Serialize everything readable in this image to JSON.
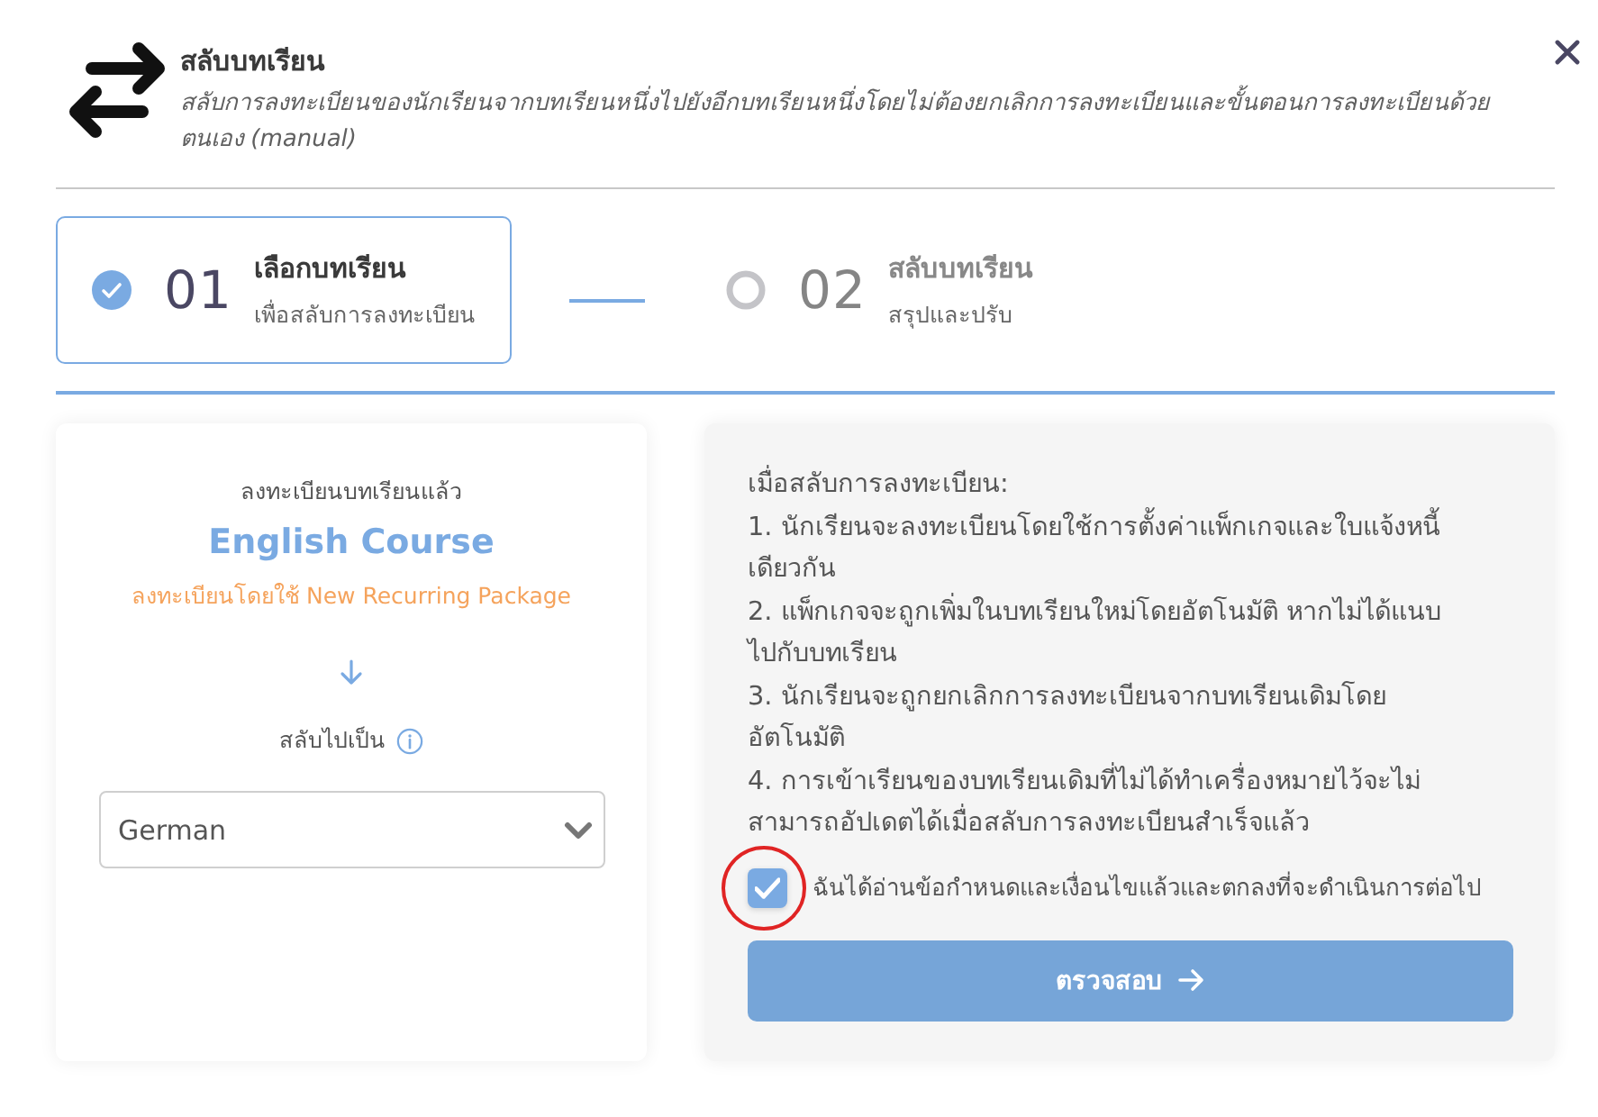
{
  "header": {
    "title": "สลับบทเรียน",
    "description": "สลับการลงทะเบียนของนักเรียนจากบทเรียนหนึ่งไปยังอีกบทเรียนหนึ่งโดยไม่ต้องยกเลิกการลงทะเบียนและขั้นตอนการลงทะเบียนด้วยตนเอง (manual)"
  },
  "steps": [
    {
      "number": "01",
      "title": "เลือกบทเรียน",
      "subtitle": "เพื่อสลับการลงทะเบียน",
      "selected": true
    },
    {
      "number": "02",
      "title": "สลับบทเรียน",
      "subtitle": "สรุปและปรับ",
      "selected": false
    }
  ],
  "source": {
    "label": "ลงทะเบียนบทเรียนแล้ว",
    "course": "English Course",
    "package_note": "ลงทะเบียนโดยใช้ New Recurring Package"
  },
  "target": {
    "label": "สลับไปเป็น",
    "select": {
      "value": "German"
    }
  },
  "notice": {
    "heading": "เมื่อสลับการลงทะเบียน:",
    "items": [
      "1. นักเรียนจะลงทะเบียนโดยใช้การตั้งค่าแพ็กเกจและใบแจ้งหนี้เดียวกัน",
      "2. แพ็กเกจจะถูกเพิ่มในบทเรียนใหม่โดยอัตโนมัติ หากไม่ได้แนบไปกับบทเรียน",
      "3. นักเรียนจะถูกยกเลิกการลงทะเบียนจากบทเรียนเดิมโดยอัตโนมัติ",
      "4. การเข้าเรียนของบทเรียนเดิมที่ไม่ได้ทำเครื่องหมายไว้จะไม่สามารถอัปเดตได้เมื่อสลับการลงทะเบียนสำเร็จแล้ว"
    ]
  },
  "agreement": {
    "label": "ฉันได้อ่านข้อกำหนดและเงื่อนไขแล้วและตกลงที่จะดำเนินการต่อไป",
    "checked": true
  },
  "submit_button": {
    "label": "ตรวจสอบ"
  }
}
